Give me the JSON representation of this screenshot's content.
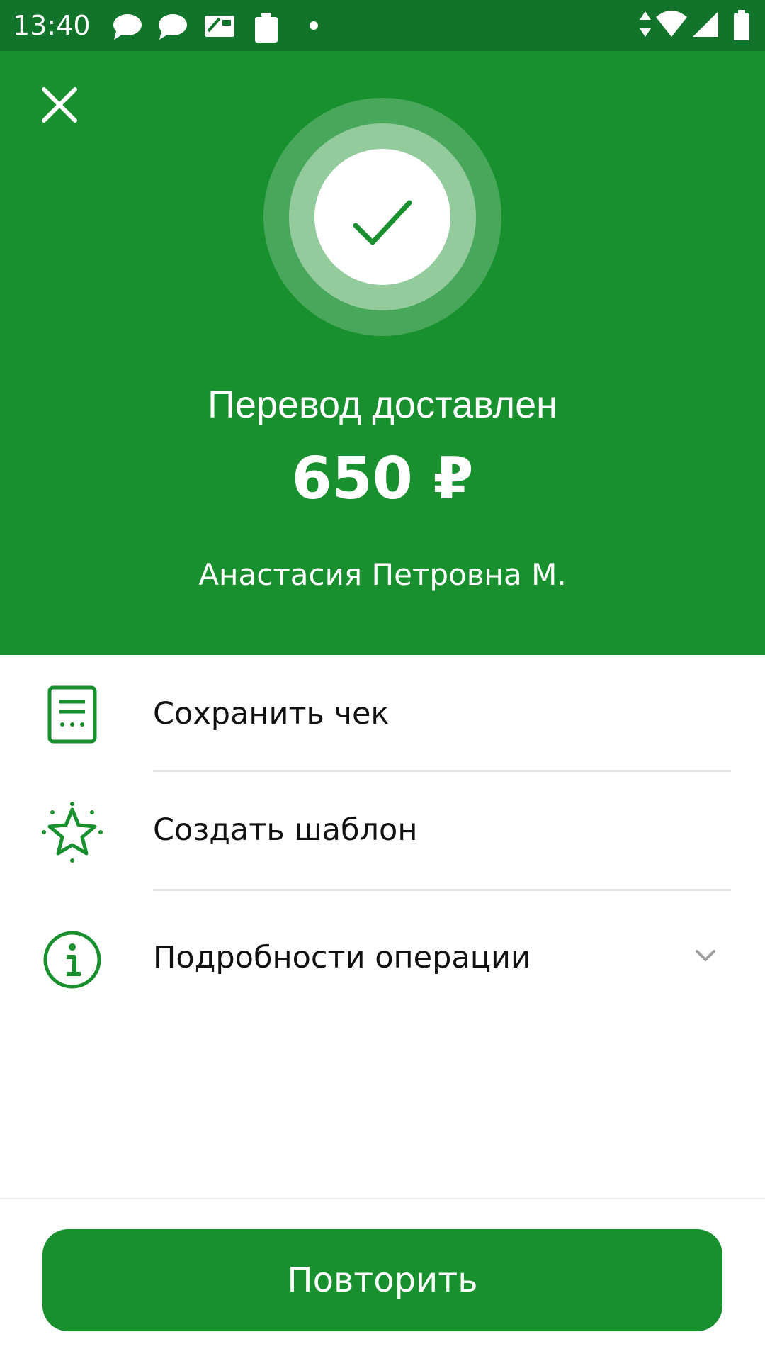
{
  "status_bar": {
    "time": "13:40"
  },
  "header": {
    "close_icon": "close-icon",
    "status_icon": "checkmark-icon",
    "title": "Перевод доставлен",
    "amount": "650 ₽",
    "recipient": "Анастасия Петровна М."
  },
  "actions": [
    {
      "label": "Сохранить чек",
      "icon": "receipt-icon"
    },
    {
      "label": "Создать шаблон",
      "icon": "star-icon"
    },
    {
      "label": "Подробности операции",
      "icon": "info-icon",
      "expand_icon": "chevron-down-icon"
    }
  ],
  "footer": {
    "repeat_label": "Повторить"
  },
  "colors": {
    "brand_green": "#17902d",
    "status_bar_green": "#11742a"
  }
}
